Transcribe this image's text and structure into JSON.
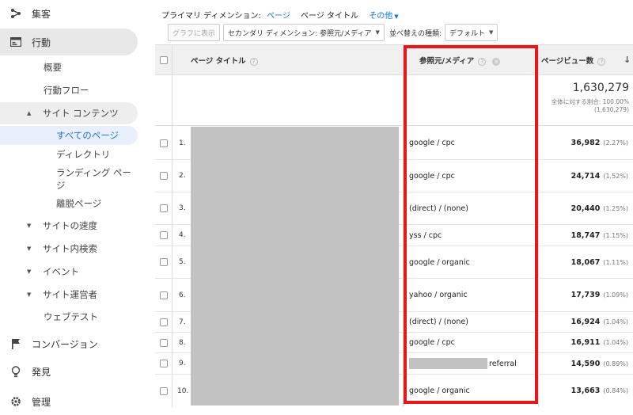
{
  "sidebar": {
    "audience": "集客",
    "behavior": "行動",
    "overview": "概要",
    "behavior_flow": "行動フロー",
    "site_content": "サイト コンテンツ",
    "all_pages": "すべてのページ",
    "directory": "ディレクトリ",
    "landing_pages": "ランディング ページ",
    "exit_pages": "離脱ページ",
    "site_speed": "サイトの速度",
    "site_search": "サイト内検索",
    "events": "イベント",
    "publisher": "サイト運営者",
    "experiments": "ウェブテスト",
    "conversions": "コンバージョン",
    "discover": "発見",
    "admin": "管理"
  },
  "dimension_bar": {
    "label": "プライマリ ディメンション:",
    "page": "ページ",
    "page_title": "ページ タイトル",
    "other": "その他"
  },
  "toolbar": {
    "graph_button": "グラフに表示",
    "secondary_dimension": "セカンダリ ディメンション: 参照元/メディア",
    "sort_type_label": "並べ替えの種類:",
    "sort_default": "デフォルト"
  },
  "table": {
    "col_page_title": "ページ タイトル",
    "col_source_medium": "参照元/メディア",
    "col_pageviews": "ページビュー数",
    "total_value": "1,630,279",
    "total_pct_label": "全体に対する割合: 100.00%",
    "total_pct_value": "(1,630,279)",
    "rows": [
      {
        "num": "1.",
        "source": "google / cpc",
        "value": "36,982",
        "pct": "(2.27%)"
      },
      {
        "num": "2.",
        "source": "google / cpc",
        "value": "24,714",
        "pct": "(1.52%)"
      },
      {
        "num": "3.",
        "source": "(direct) / (none)",
        "value": "20,440",
        "pct": "(1.25%)"
      },
      {
        "num": "4.",
        "source": "yss / cpc",
        "value": "18,747",
        "pct": "(1.15%)"
      },
      {
        "num": "5.",
        "source": "google / organic",
        "value": "18,067",
        "pct": "(1.11%)"
      },
      {
        "num": "6.",
        "source": "yahoo / organic",
        "value": "17,739",
        "pct": "(1.09%)"
      },
      {
        "num": "7.",
        "source": "(direct) / (none)",
        "value": "16,924",
        "pct": "(1.04%)"
      },
      {
        "num": "8.",
        "source": "google / cpc",
        "value": "16,911",
        "pct": "(1.04%)"
      },
      {
        "num": "9.",
        "source": "referral",
        "value": "14,590",
        "pct": "(0.89%)"
      },
      {
        "num": "10.",
        "source": "google / organic",
        "value": "13,663",
        "pct": "(0.84%)"
      }
    ]
  },
  "colors": {
    "accent": "#1a73e8",
    "highlight_box": "#e5181c",
    "redaction": "#c2c2c2"
  }
}
